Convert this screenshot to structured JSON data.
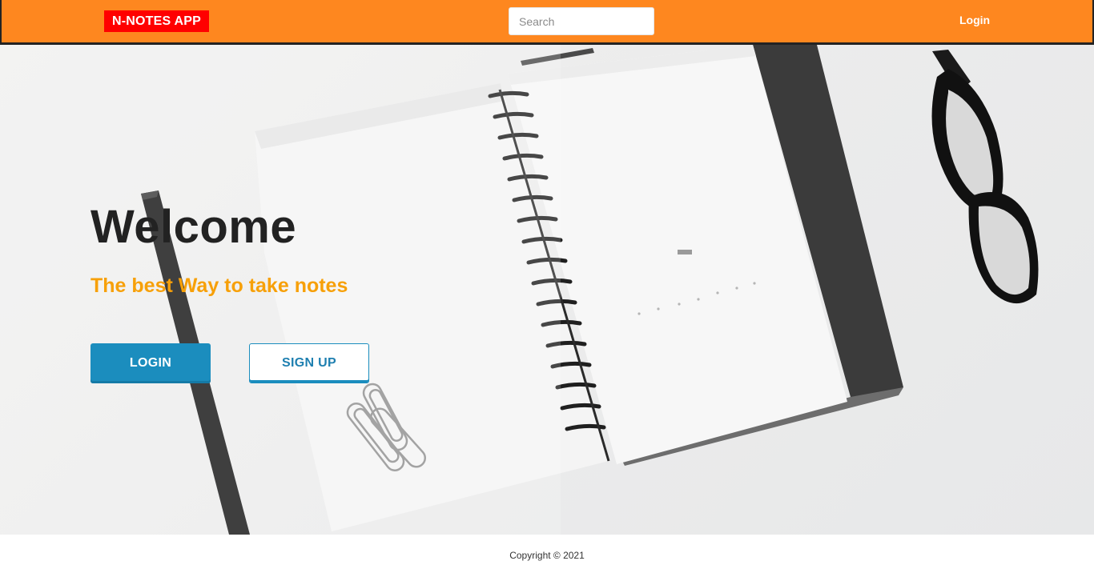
{
  "navbar": {
    "brand": "N-NOTES APP",
    "search_placeholder": "Search",
    "login_link": "Login"
  },
  "hero": {
    "headline": "Welcome",
    "tagline": "The best Way to take notes",
    "login_button": "LOGIN",
    "signup_button": "SIGN UP",
    "background_icons": [
      "notebook-image",
      "pencil-image",
      "paper-clips-image",
      "glasses-image"
    ]
  },
  "footer": {
    "copyright": "Copyright © 2021"
  },
  "colors": {
    "navbar_bg": "#fe871f",
    "brand_bg": "#ff0000",
    "tagline": "#f7a008",
    "primary_button": "#1b8dbe"
  }
}
